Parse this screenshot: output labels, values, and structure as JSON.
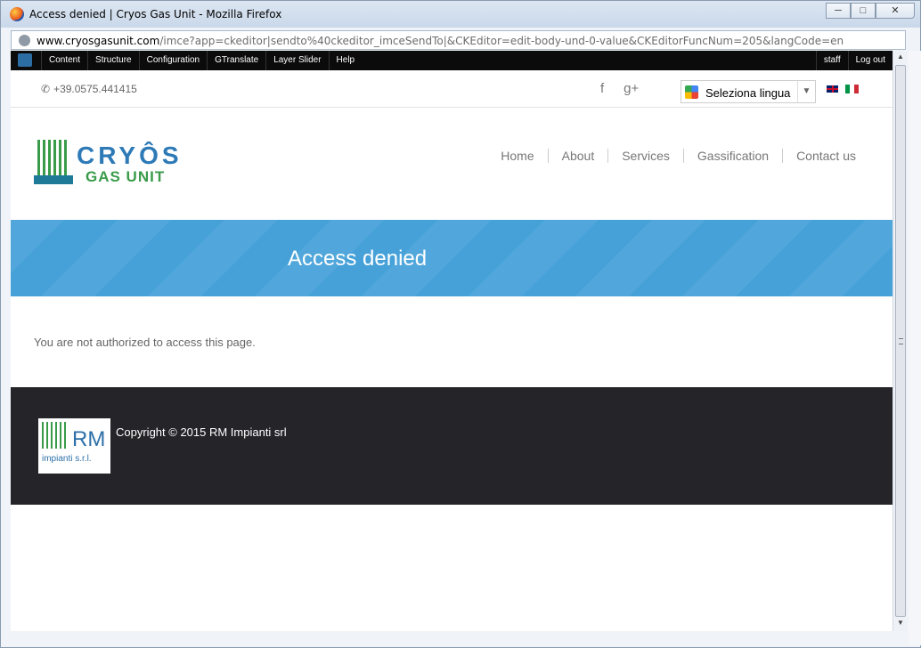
{
  "window": {
    "title": "Access denied | Cryos Gas Unit - Mozilla Firefox"
  },
  "urlbar": {
    "domain": "www.cryosgasunit.com",
    "path": "/imce?app=ckeditor|sendto%40ckeditor_imceSendTo|&CKEditor=edit-body-und-0-value&CKEditorFuncNum=205&langCode=en"
  },
  "admin": {
    "menu": [
      "Content",
      "Structure",
      "Configuration",
      "GTranslate",
      "Layer Slider",
      "Help"
    ],
    "user": "staff",
    "logout": "Log out"
  },
  "topbar": {
    "phone": "+39.0575.441415",
    "facebook": "f",
    "gplus": "g+",
    "language_select": "Seleziona lingua"
  },
  "logo": {
    "title": "CRYÔS",
    "subtitle": "GAS UNIT"
  },
  "nav": [
    "Home",
    "About",
    "Services",
    "Gassification",
    "Contact us"
  ],
  "page": {
    "title": "Access denied",
    "message": "You are not authorized to access this page."
  },
  "footer": {
    "logo_text": "RM",
    "logo_sub": "impianti s.r.l.",
    "copyright": "Copyright © 2015 RM Impianti srl"
  }
}
